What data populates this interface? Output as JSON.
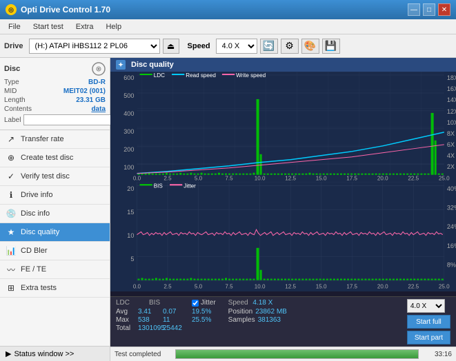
{
  "titleBar": {
    "title": "Opti Drive Control 1.70",
    "icon": "◎",
    "controls": [
      "—",
      "□",
      "✕"
    ]
  },
  "menuBar": {
    "items": [
      "File",
      "Start test",
      "Extra",
      "Help"
    ]
  },
  "toolbar": {
    "driveLabel": "Drive",
    "driveValue": "(H:) ATAPI iHBS112  2 PL06",
    "speedLabel": "Speed",
    "speedValue": "4.0 X"
  },
  "discInfo": {
    "title": "Disc",
    "fields": [
      {
        "label": "Type",
        "value": "BD-R"
      },
      {
        "label": "MID",
        "value": "MEIT02 (001)"
      },
      {
        "label": "Length",
        "value": "23.31 GB"
      },
      {
        "label": "Contents",
        "value": "data"
      },
      {
        "label": "Label",
        "value": ""
      }
    ]
  },
  "sidebarItems": [
    {
      "label": "Transfer rate",
      "icon": "↗",
      "active": false
    },
    {
      "label": "Create test disc",
      "icon": "⊕",
      "active": false
    },
    {
      "label": "Verify test disc",
      "icon": "✓",
      "active": false
    },
    {
      "label": "Drive info",
      "icon": "ℹ",
      "active": false
    },
    {
      "label": "Disc info",
      "icon": "💿",
      "active": false
    },
    {
      "label": "Disc quality",
      "icon": "★",
      "active": true
    },
    {
      "label": "CD Bler",
      "icon": "📊",
      "active": false
    },
    {
      "label": "FE / TE",
      "icon": "〰",
      "active": false
    },
    {
      "label": "Extra tests",
      "icon": "⊞",
      "active": false
    }
  ],
  "statusWindow": {
    "label": "Status window >>",
    "text": "Test completed"
  },
  "chartTitle": "Disc quality",
  "chartLegend": {
    "upperChart": [
      {
        "label": "LDC",
        "color": "#00ff00"
      },
      {
        "label": "Read speed",
        "color": "#00ccff"
      },
      {
        "label": "Write speed",
        "color": "#ff66aa"
      }
    ],
    "lowerChart": [
      {
        "label": "BIS",
        "color": "#00ff00"
      },
      {
        "label": "Jitter",
        "color": "#ff66aa"
      }
    ]
  },
  "stats": {
    "headers": [
      "LDC",
      "BIS",
      "",
      "Jitter",
      "Speed",
      ""
    ],
    "rows": [
      {
        "label": "Avg",
        "ldc": "3.41",
        "bis": "0.07",
        "jitter": "19.5%",
        "speed": "4.18 X"
      },
      {
        "label": "Max",
        "ldc": "538",
        "bis": "11",
        "jitter": "25.5%",
        "position": "23862 MB"
      },
      {
        "label": "Total",
        "ldc": "1301095",
        "bis": "25442",
        "samples": "381363"
      }
    ],
    "speedDropdown": "4.0 X",
    "startFull": "Start full",
    "startPart": "Start part"
  },
  "progress": {
    "label": "Test completed",
    "percent": 100,
    "time": "33:16"
  },
  "upperChart": {
    "yAxisLeft": [
      "600",
      "500",
      "400",
      "300",
      "200",
      "100"
    ],
    "yAxisRight": [
      "18X",
      "16X",
      "14X",
      "12X",
      "10X",
      "8X",
      "6X",
      "4X",
      "2X"
    ],
    "xAxis": [
      "0.0",
      "2.5",
      "5.0",
      "7.5",
      "10.0",
      "12.5",
      "15.0",
      "17.5",
      "20.0",
      "22.5",
      "25.0"
    ]
  },
  "lowerChart": {
    "yAxisLeft": [
      "20",
      "15",
      "10",
      "5"
    ],
    "yAxisRight": [
      "40%",
      "32%",
      "24%",
      "16%",
      "8%"
    ],
    "xAxis": [
      "0.0",
      "2.5",
      "5.0",
      "7.5",
      "10.0",
      "12.5",
      "15.0",
      "17.5",
      "20.0",
      "22.5",
      "25.0"
    ]
  }
}
